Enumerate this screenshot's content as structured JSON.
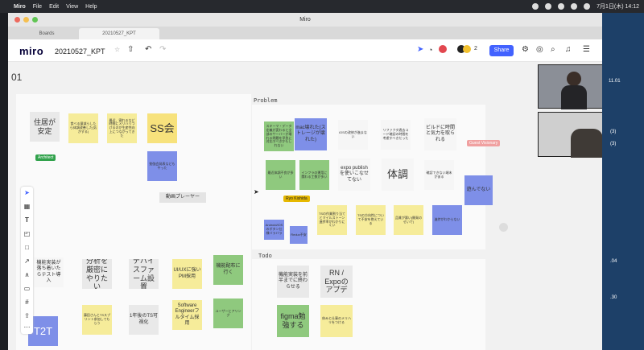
{
  "menubar": {
    "app": "Miro",
    "items": [
      "File",
      "Edit",
      "View",
      "Help"
    ],
    "time": "7月1日(木) 14:12"
  },
  "window": {
    "title": "Miro"
  },
  "tabs": [
    {
      "label": "Boards"
    },
    {
      "label": "20210527_KPT"
    }
  ],
  "toolbar": {
    "logo": "miro",
    "board_name": "20210527_KPT",
    "collab_count": "2",
    "share_label": "Share"
  },
  "canvas": {
    "frame_label_left": "01",
    "frame_label_problem": "Problem",
    "frame_label_todo": "Todo",
    "video_player_label": "動画プレーヤー",
    "cursor_labels": {
      "guest": "Guest Visionary",
      "ryo": "Ryo Kishida",
      "architect": "Architect"
    }
  },
  "keep_notes": [
    {
      "text": "住居が安定",
      "color": "gr"
    },
    {
      "text": "食べる量減らしたら体調改善した(気がする)",
      "color": "y"
    },
    {
      "text": "最近、寝れるなど時間にメリハリつけるのが生産性向上につながってきた",
      "color": "y"
    },
    {
      "text": "SS会",
      "color": "o"
    },
    {
      "text": "勉強会発表などもやった",
      "color": "b"
    },
    {
      "text": "機能実装が落ち着いたらテスト導入",
      "color": "w"
    },
    {
      "text": "分析を厳密にやりたい",
      "color": "gr"
    },
    {
      "text": "デバイスファーム設置",
      "color": "gr"
    },
    {
      "text": "UI/UXに強いPM採用",
      "color": "y"
    },
    {
      "text": "機能配布に行く",
      "color": "g"
    },
    {
      "text": "藤田さんとTSスプリント参加してもらう",
      "color": "y"
    },
    {
      "text": "1年後のTS可視化",
      "color": "gr"
    },
    {
      "text": "Software Engineerフルタイム採用",
      "color": "y"
    },
    {
      "text": "ユーザーヒアリング",
      "color": "g"
    },
    {
      "text": "T2T",
      "color": "b"
    }
  ],
  "problem_notes": [
    {
      "text": "スキーマ・データ定義が変わると全部のサーバーが壊れる問題を早急に対応すべきかもしれない",
      "color": "g"
    },
    {
      "text": "mac壊れた(ストレージが壊れた)",
      "color": "b"
    },
    {
      "text": "iOSの改修が進まない",
      "color": "w"
    },
    {
      "text": "リファクタ過去コード確認の時間を考慮すべきだった",
      "color": "w"
    },
    {
      "text": "ビルドに時間と気力を取られる",
      "color": "w"
    },
    {
      "text": "最近体調不良が多い",
      "color": "g"
    },
    {
      "text": "インフラの運用に関わる工数が多い",
      "color": "g"
    },
    {
      "text": "expo publishを使いこなせてない",
      "color": "w"
    },
    {
      "text": "体調",
      "color": "w"
    },
    {
      "text": "確認できない端末がある",
      "color": "w"
    },
    {
      "text": "遊んでない",
      "color": "b"
    },
    {
      "text": "TSの作業割り当てとマイルストーン進捗率がわかりにくい",
      "color": "y"
    },
    {
      "text": "TSの方向性について不安を抱えている",
      "color": "y"
    },
    {
      "text": "品質が悪い(開発のせいで)",
      "color": "y"
    },
    {
      "text": "進捗がわからない",
      "color": "b"
    },
    {
      "text": "Android/iOSのボタン仕様バラバラ",
      "color": "b"
    },
    {
      "text": "Redux不安",
      "color": "b"
    }
  ],
  "todo_notes": [
    {
      "text": "機能実装を前半までに終わらせる",
      "color": "gr"
    },
    {
      "text": "RN / Expoのアプデ",
      "color": "gr"
    },
    {
      "text": "figma勉強する",
      "color": "g"
    },
    {
      "text": "休みと仕事のメリハリをつける",
      "color": "y"
    }
  ],
  "dock": {
    "dates": [
      "11.01",
      "(3)",
      "(3)",
      ".04",
      ".30"
    ]
  },
  "colors": {
    "yellow": "#f6ec9a",
    "green": "#8fc97e",
    "blue": "#7e8fe8",
    "share": "#4262ff"
  }
}
